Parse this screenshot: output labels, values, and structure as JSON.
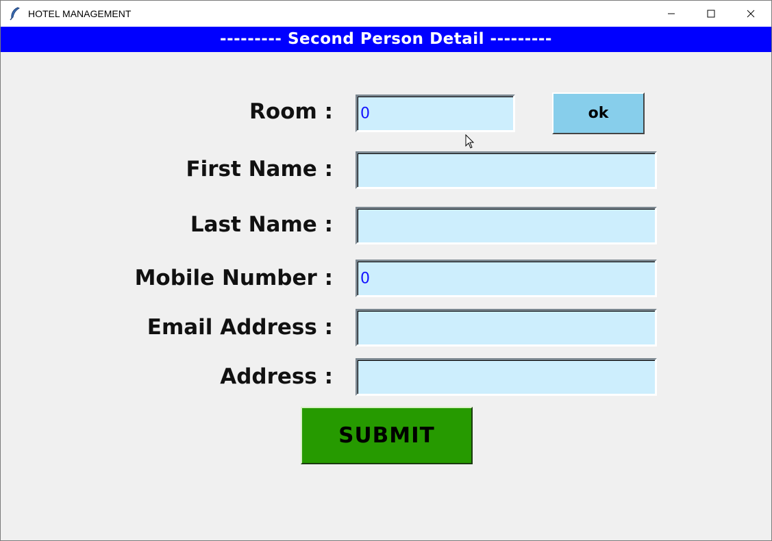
{
  "window": {
    "title": "HOTEL MANAGEMENT",
    "icons": {
      "app": "feather-icon",
      "minimize": "minimize-icon",
      "maximize": "maximize-icon",
      "close": "close-icon"
    }
  },
  "banner": {
    "text": "---------  Second Person Detail ---------"
  },
  "form": {
    "room": {
      "label": "Room :",
      "value": "0"
    },
    "ok_button": "ok",
    "first_name": {
      "label": "First Name :",
      "value": ""
    },
    "last_name": {
      "label": "Last Name :",
      "value": ""
    },
    "mobile": {
      "label": "Mobile Number :",
      "value": "0"
    },
    "email": {
      "label": "Email Address :",
      "value": ""
    },
    "address": {
      "label": "Address :",
      "value": ""
    },
    "submit_button": "SUBMIT"
  },
  "colors": {
    "banner_bg": "#0000ff",
    "entry_bg": "#cdeefd",
    "entry_text": "#1212ff",
    "ok_bg": "#87ceeb",
    "submit_bg": "#269a00"
  }
}
